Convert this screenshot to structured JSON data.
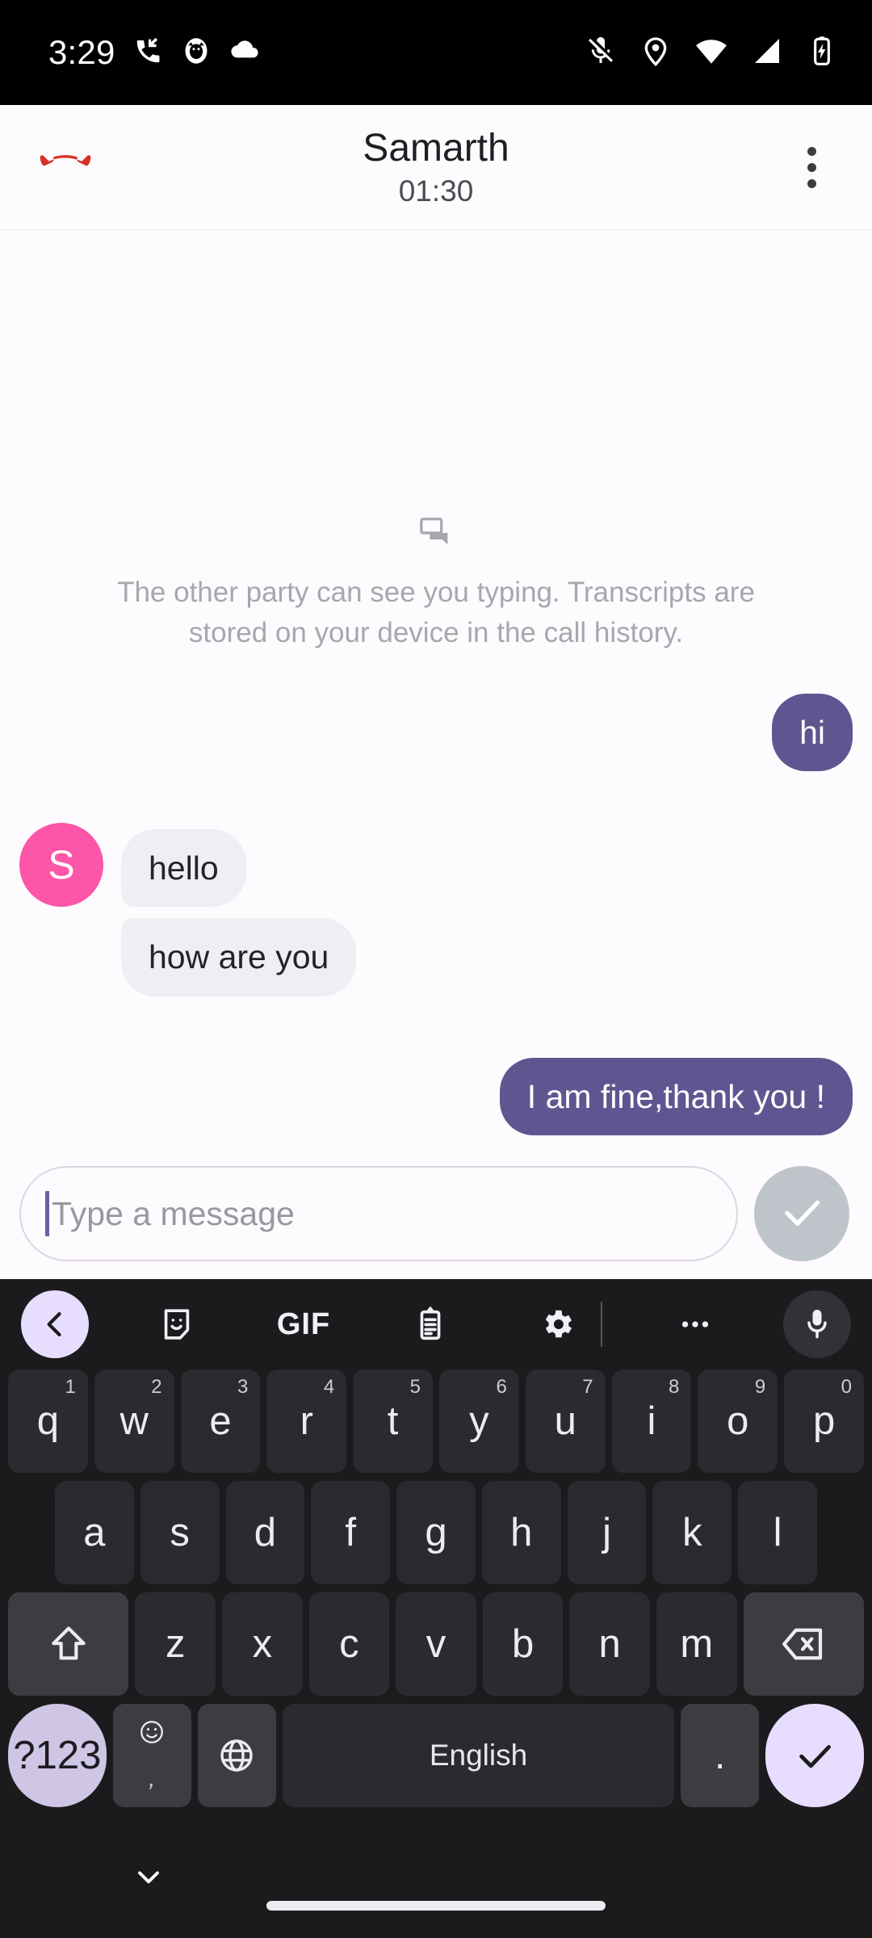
{
  "status_bar": {
    "clock": "3:29",
    "left_icons": [
      "missed-call-icon",
      "cat-avatar-icon",
      "cloud-icon"
    ],
    "right_icons": [
      "mic-off-icon",
      "location-icon",
      "wifi-icon",
      "signal-icon",
      "battery-charging-icon"
    ]
  },
  "call_header": {
    "end_call_icon": "call-end-icon",
    "contact_name": "Samarth",
    "timer": "01:30",
    "overflow_icon": "more-vert-icon",
    "end_call_color": "#d93025"
  },
  "conversation": {
    "hint_icon": "rtt-chat-icon",
    "hint_text": "The other party can see you typing. Transcripts are stored on your device in the call history.",
    "avatar_initial": "S",
    "avatar_color": "#fd55a7",
    "outgoing_color": "#605590",
    "incoming_color": "#f0edf3",
    "messages": [
      {
        "side": "out",
        "text": "hi"
      },
      {
        "side": "in",
        "text": "hello"
      },
      {
        "side": "in",
        "text": "how are you"
      },
      {
        "side": "out",
        "text": "I am fine,thank you !"
      }
    ]
  },
  "composer": {
    "placeholder": "Type a message",
    "value": "",
    "send_icon": "check-icon",
    "send_button_color": "#bfc4ca",
    "caret_color": "#6b5fa3"
  },
  "keyboard": {
    "toolbar": [
      {
        "name": "back-chevron-icon",
        "label": ""
      },
      {
        "name": "sticker-icon",
        "label": ""
      },
      {
        "name": "gif-icon",
        "label": "GIF"
      },
      {
        "name": "clipboard-icon",
        "label": ""
      },
      {
        "name": "gear-icon",
        "label": ""
      },
      {
        "name": "divider",
        "label": ""
      },
      {
        "name": "more-horiz-icon",
        "label": ""
      },
      {
        "name": "mic-icon",
        "label": ""
      }
    ],
    "row1": [
      {
        "key": "q",
        "sup": "1"
      },
      {
        "key": "w",
        "sup": "2"
      },
      {
        "key": "e",
        "sup": "3"
      },
      {
        "key": "r",
        "sup": "4"
      },
      {
        "key": "t",
        "sup": "5"
      },
      {
        "key": "y",
        "sup": "6"
      },
      {
        "key": "u",
        "sup": "7"
      },
      {
        "key": "i",
        "sup": "8"
      },
      {
        "key": "o",
        "sup": "9"
      },
      {
        "key": "p",
        "sup": "0"
      }
    ],
    "row2": [
      "a",
      "s",
      "d",
      "f",
      "g",
      "h",
      "j",
      "k",
      "l"
    ],
    "row3_letters": [
      "z",
      "x",
      "c",
      "v",
      "b",
      "n",
      "m"
    ],
    "shift_icon": "shift-icon",
    "backspace_icon": "backspace-icon",
    "row4": {
      "numbers_label": "?123",
      "comma_label": ",",
      "emoji_icon": "emoji-icon",
      "globe_icon": "globe-icon",
      "space_label": "English",
      "period_label": ".",
      "enter_icon": "check-icon"
    },
    "accent_color": "#e7deff",
    "key_color": "#2b2b2f",
    "special_key_color": "#3c3c41"
  },
  "nav_bar": {
    "hide_keyboard_icon": "chevron-down-icon",
    "home_indicator": "home-gesture-bar"
  }
}
